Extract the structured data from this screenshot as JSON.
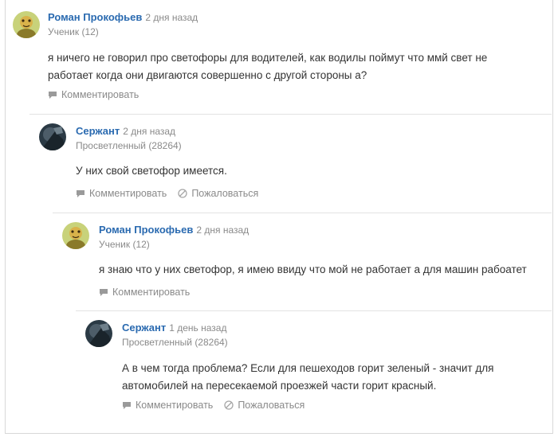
{
  "comments": [
    {
      "author": "Роман Прокофьев",
      "time": "2 дня назад",
      "rank": "Ученик (12)",
      "text": "я ничего не говорил про светофоры для водителей, как водилы поймут что ммй свет не работает когда они двигаются совершенно с другой стороны а?",
      "actions": [
        "Комментировать"
      ]
    },
    {
      "author": "Сержант",
      "time": "2 дня назад",
      "rank": "Просветленный (28264)",
      "text": "У них свой светофор имеется.",
      "actions": [
        "Комментировать",
        "Пожаловаться"
      ]
    },
    {
      "author": "Роман Прокофьев",
      "time": "2 дня назад",
      "rank": "Ученик (12)",
      "text": "я знаю что у них светофор, я имею ввиду что мой не работает а для машин рабоатет",
      "actions": [
        "Комментировать"
      ]
    },
    {
      "author": "Сержант",
      "time": "1 день назад",
      "rank": "Просветленный (28264)",
      "text": "А в чем тогда проблема? Если для пешеходов горит зеленый - значит для автомобилей на пересекаемой проезжей части горит красный.",
      "actions": [
        "Комментировать",
        "Пожаловаться"
      ]
    }
  ]
}
